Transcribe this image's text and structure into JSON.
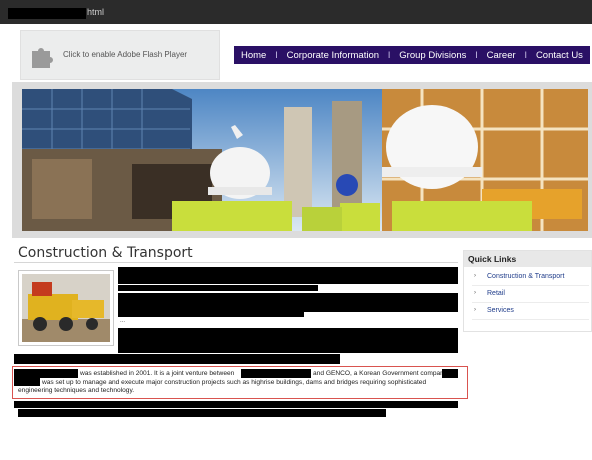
{
  "window": {
    "title_suffix": "html"
  },
  "flash_placeholder": {
    "message": "Click to enable Adobe Flash Player",
    "icon": "puzzle-piece-icon"
  },
  "nav": {
    "items": [
      "Home",
      "Corporate Information",
      "Group Divisions",
      "Career",
      "Contact Us"
    ],
    "separator": "I"
  },
  "page": {
    "heading": "Construction & Transport",
    "partial_text": "...",
    "paragraph": {
      "line1_part1": "was established in 2001. It is a joint venture between",
      "line1_part2": "and GENCO, a Korean Government company.",
      "line2_part1": "was set up to manage and execute major construction projects such as highrise buildings, dams and bridges requiring sophisticated",
      "line3": "engineering techniques and technology."
    }
  },
  "quick_links": {
    "title": "Quick Links",
    "items": [
      "Construction & Transport",
      "Retail",
      "Services"
    ]
  },
  "colors": {
    "nav_bg": "#2a1065",
    "highlight_border": "#d9534f",
    "link": "#1f3c8a"
  }
}
